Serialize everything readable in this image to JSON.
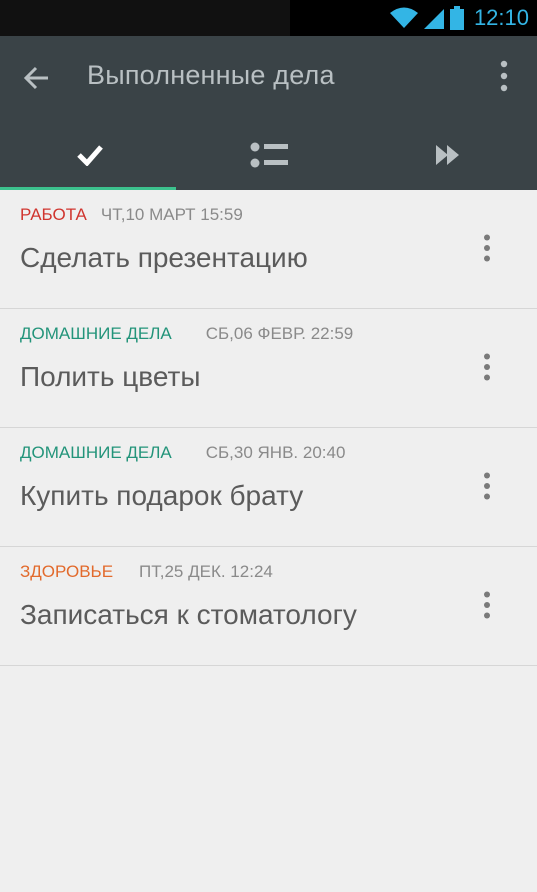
{
  "status_bar": {
    "time": "12:10",
    "accent": "#33b5e5"
  },
  "action_bar": {
    "title": "Выполненные дела",
    "back_icon": "arrow-back-icon",
    "menu_icon": "overflow-menu-icon"
  },
  "tabs": [
    {
      "icon": "check-icon",
      "selected": true
    },
    {
      "icon": "list-icon",
      "selected": false
    },
    {
      "icon": "fast-forward-icon",
      "selected": false
    }
  ],
  "tab_indicator_color": "#3cc28e",
  "tasks": [
    {
      "category": "РАБОТА",
      "category_color": "#d0352f",
      "date": "ЧТ,10 МАРТ 15:59",
      "title": "Сделать презентацию"
    },
    {
      "category": "ДОМАШНИЕ ДЕЛА",
      "category_color": "#23947a",
      "date": "СБ,06 ФЕВР. 22:59",
      "title": "Полить цветы"
    },
    {
      "category": "ДОМАШНИЕ ДЕЛА",
      "category_color": "#23947a",
      "date": "СБ,30 ЯНВ. 20:40",
      "title": "Купить подарок брату"
    },
    {
      "category": "ЗДОРОВЬЕ",
      "category_color": "#e26a2c",
      "date": "ПТ,25 ДЕК. 12:24",
      "title": "Записаться к стоматологу"
    }
  ]
}
